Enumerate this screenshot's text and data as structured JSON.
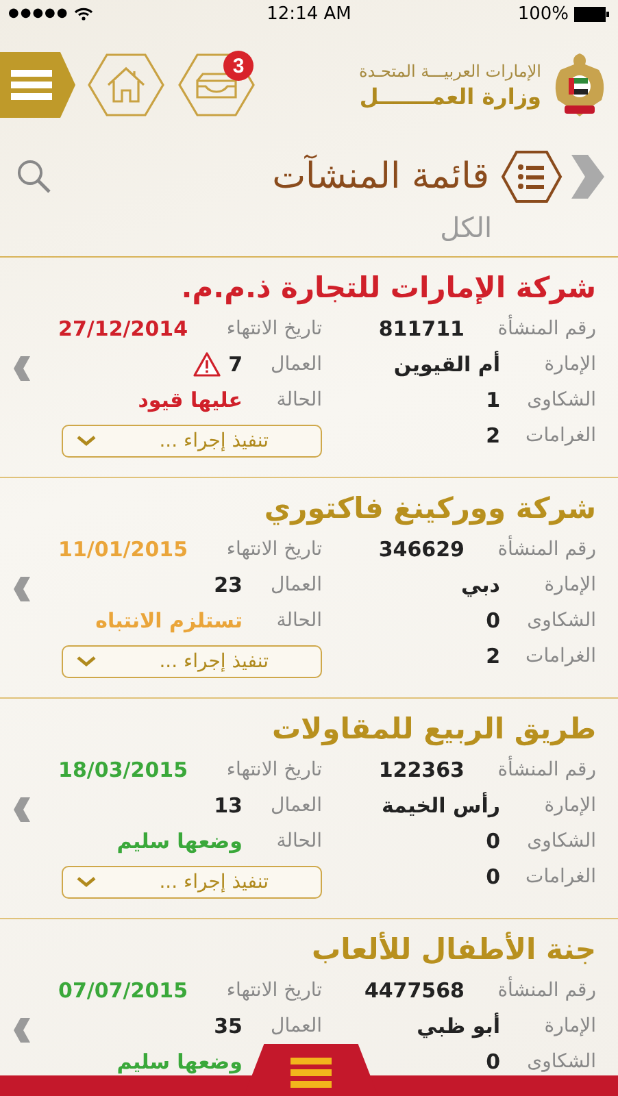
{
  "status_bar": {
    "signal": "●●●●●",
    "time": "12:14 AM",
    "battery": "100%"
  },
  "header": {
    "inbox_badge": "3",
    "country": "الإمارات العربيـــة المتحـدة",
    "ministry": "وزارة العمـــــــل"
  },
  "page": {
    "title": "قائمة المنشآت",
    "filter": "الكل"
  },
  "cards": [
    {
      "kind": "expired",
      "title": "شركة الإمارات للتجارة ذ.م.م.",
      "number_label": "رقم المنشأة",
      "number": "811711",
      "emirate_label": "الإمارة",
      "emirate": "أم القيوين",
      "complaints_label": "الشكاوى",
      "complaints": "1",
      "fines_label": "الغرامات",
      "fines": "2",
      "expiry_label": "تاريخ الانتهاء",
      "expiry": "27/12/2014",
      "workers_label": "العمال",
      "workers": "7",
      "workers_alert": true,
      "status_label": "الحالة",
      "status": "عليها قيود",
      "action": "تنفيذ إجراء ..."
    },
    {
      "kind": "warning",
      "title": "شركة ووركينغ فاكتوري",
      "number_label": "رقم المنشأة",
      "number": "346629",
      "emirate_label": "الإمارة",
      "emirate": "دبي",
      "complaints_label": "الشكاوى",
      "complaints": "0",
      "fines_label": "الغرامات",
      "fines": "2",
      "expiry_label": "تاريخ الانتهاء",
      "expiry": "11/01/2015",
      "workers_label": "العمال",
      "workers": "23",
      "workers_alert": false,
      "status_label": "الحالة",
      "status": "تستلزم الانتباه",
      "action": "تنفيذ إجراء ..."
    },
    {
      "kind": "ok",
      "title": "طريق الربيع للمقاولات",
      "number_label": "رقم المنشأة",
      "number": "122363",
      "emirate_label": "الإمارة",
      "emirate": "رأس الخيمة",
      "complaints_label": "الشكاوى",
      "complaints": "0",
      "fines_label": "الغرامات",
      "fines": "0",
      "expiry_label": "تاريخ الانتهاء",
      "expiry": "18/03/2015",
      "workers_label": "العمال",
      "workers": "13",
      "workers_alert": false,
      "status_label": "الحالة",
      "status": "وضعها سليم",
      "action": "تنفيذ إجراء ..."
    },
    {
      "kind": "ok",
      "title": "جنة الأطفال للألعاب",
      "number_label": "رقم المنشأة",
      "number": "4477568",
      "emirate_label": "الإمارة",
      "emirate": "أبو ظبي",
      "complaints_label": "الشكاوى",
      "complaints": "0",
      "expiry_label": "تاريخ الانتهاء",
      "expiry": "07/07/2015",
      "workers_label": "العمال",
      "workers": "35",
      "workers_alert": false,
      "status": "وضعها سليم"
    }
  ]
}
